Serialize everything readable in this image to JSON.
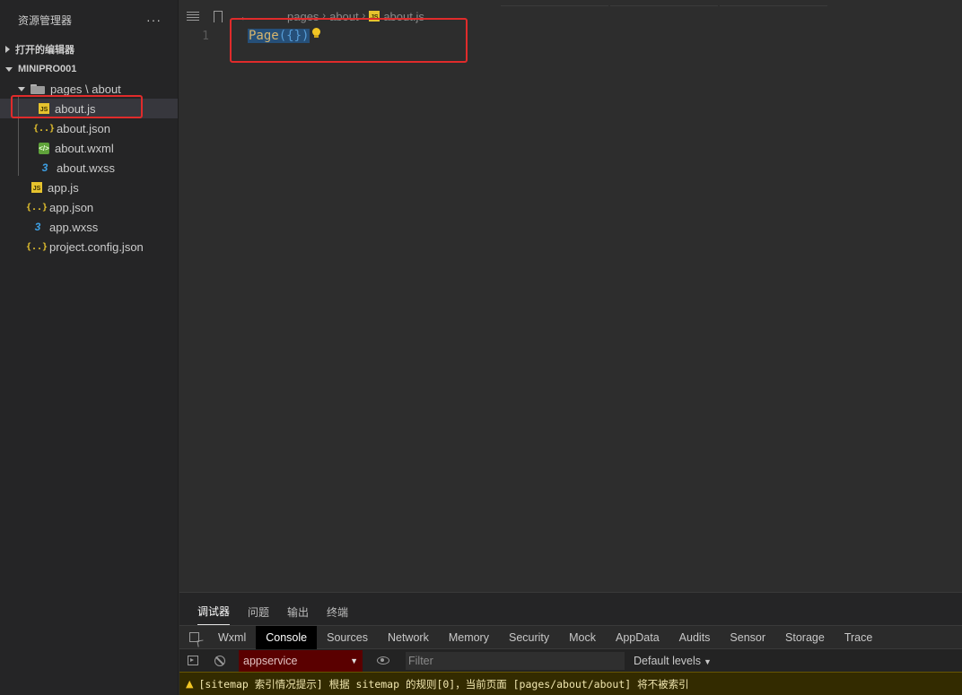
{
  "sidebar": {
    "title": "资源管理器",
    "more": "···",
    "open_editors": "打开的编辑器",
    "project": "MINIPRO001",
    "folder": "pages \\ about",
    "files_sub": [
      {
        "name": "about.js",
        "icon": "js-file-icon",
        "selected": true
      },
      {
        "name": "about.json",
        "icon": "json-file-icon"
      },
      {
        "name": "about.wxml",
        "icon": "wxml-file-icon"
      },
      {
        "name": "about.wxss",
        "icon": "wxss-file-icon"
      }
    ],
    "files_root": [
      {
        "name": "app.js",
        "icon": "js-file-icon"
      },
      {
        "name": "app.json",
        "icon": "json-file-icon"
      },
      {
        "name": "app.wxss",
        "icon": "wxss-file-icon"
      },
      {
        "name": "project.config.json",
        "icon": "json-file-icon"
      }
    ]
  },
  "icons": {
    "js": "JS",
    "json": "{..}",
    "wxml": "</>",
    "wxss": "3"
  },
  "editor": {
    "breadcrumb": {
      "arrow": "←",
      "seg1": "pages",
      "sep": "›",
      "seg2": "about",
      "file": "about.js"
    },
    "line_number": "1",
    "code": {
      "fn": "Page",
      "open": "({",
      "close": "})"
    }
  },
  "panel": {
    "tabs": [
      "调试器",
      "问题",
      "输出",
      "终端"
    ],
    "devtools_tabs": [
      "Wxml",
      "Console",
      "Sources",
      "Network",
      "Memory",
      "Security",
      "Mock",
      "AppData",
      "Audits",
      "Sensor",
      "Storage",
      "Trace"
    ],
    "active_devtool": "Console",
    "context": "appservice",
    "context_arrow": "▼",
    "filter_placeholder": "Filter",
    "levels": "Default levels",
    "levels_arrow": "▼",
    "warning_icon": "▲",
    "warning": "[sitemap 索引情况提示] 根据 sitemap 的规则[0]，当前页面 [pages/about/about] 将不被索引"
  },
  "colors": {
    "highlight": "#e02b2b",
    "selection": "#264f78",
    "js_badge": "#e6c32e"
  }
}
